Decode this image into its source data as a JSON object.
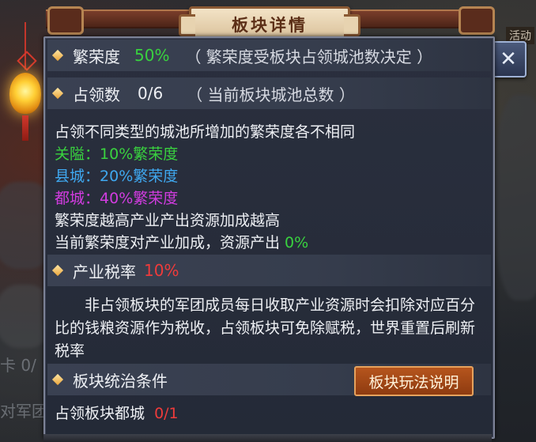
{
  "title": "板块详情",
  "background": {
    "right_label": "活动",
    "left_text_1": "卡 0/",
    "left_text_2": "对军团"
  },
  "prosperity": {
    "label": "繁荣度",
    "value": "50%",
    "note": "（ 繁荣度受板块占领城池数决定 ）"
  },
  "occupied": {
    "label": "占领数",
    "value": "0/6",
    "note": "（ 当前板块城池总数 ）"
  },
  "info": {
    "line1": "占领不同类型的城池所增加的繁荣度各不相同",
    "pass_label": "关隘：",
    "pass_value": "10%繁荣度",
    "county_label": "县城：",
    "county_value": "20%繁荣度",
    "capital_label": "都城：",
    "capital_value": "40%繁荣度",
    "line5": "繁荣度越高产业产出资源加成越高",
    "line6_prefix": "当前繁荣度对产业加成，资源产出 ",
    "line6_value": "0%"
  },
  "tax": {
    "label": "产业税率",
    "value": "10%",
    "description": "非占领板块的军团成员每日收取产业资源时会扣除对应百分比的钱粮资源作为税收，占领板块可免除赋税，世界重置后刷新税率"
  },
  "rule": {
    "label": "板块统治条件",
    "button_label": "板块玩法说明",
    "condition_label": "占领板块都城",
    "condition_value": "0/1"
  },
  "colors": {
    "green": "#39d23f",
    "red": "#ef3b3b",
    "pass": "#39d23f",
    "county": "#3fa8f0",
    "capital": "#d23ce0"
  },
  "icons": {
    "close": "close-icon",
    "bullet": "diamond-bullet-icon",
    "lantern": "lantern-icon"
  }
}
